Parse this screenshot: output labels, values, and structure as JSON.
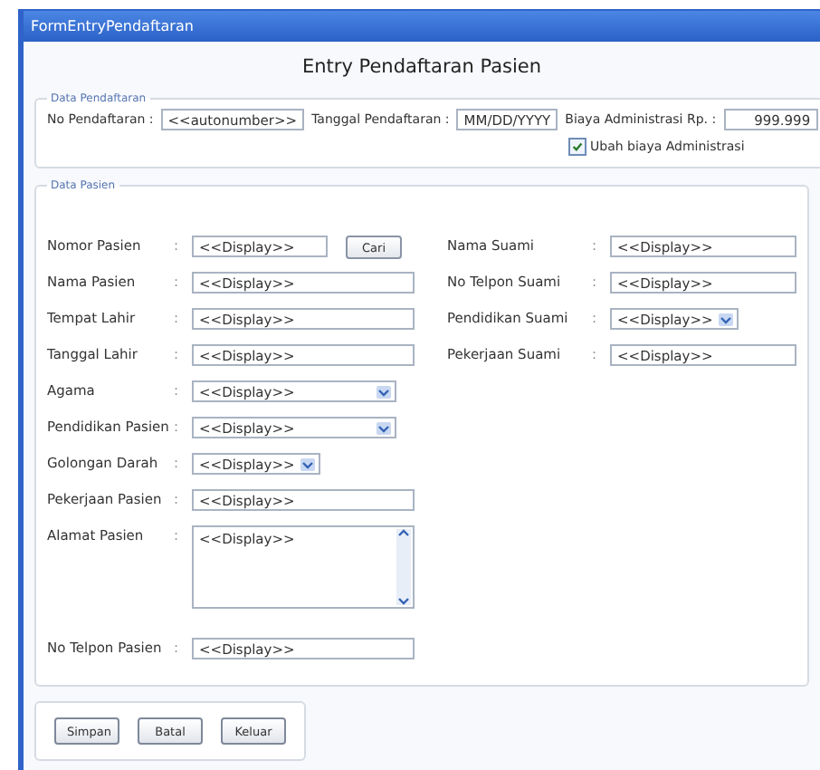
{
  "window": {
    "title": "FormEntryPendaftaran"
  },
  "heading": "Entry Pendaftaran Pasien",
  "registration": {
    "legend": "Data Pendaftaran",
    "fields": [
      {
        "label": "No Pendaftaran :",
        "value": "<<autonumber>>",
        "kind": "text"
      },
      {
        "label": "Tanggal Pendaftaran :",
        "value": "MM/DD/YYYY",
        "kind": "text"
      },
      {
        "label": "Biaya Administrasi  Rp. :",
        "value": "999.999",
        "kind": "amount"
      }
    ],
    "checkbox": {
      "label": "Ubah biaya Administrasi",
      "checked": true
    }
  },
  "patient": {
    "legend": "Data Pasien",
    "left": [
      {
        "label": "Nomor Pasien",
        "colon": ":",
        "value": "<<Display>>",
        "kind": "lookup",
        "button": "Cari"
      },
      {
        "label": "Nama Pasien",
        "colon": ":",
        "value": "<<Display>>",
        "kind": "text"
      },
      {
        "label": "Tempat Lahir",
        "colon": ":",
        "value": "<<Display>>",
        "kind": "text"
      },
      {
        "label": "Tanggal Lahir",
        "colon": ":",
        "value": "<<Display>>",
        "kind": "text"
      },
      {
        "label": "Agama",
        "colon": ":",
        "value": "<<Display>>",
        "kind": "combo"
      },
      {
        "label": "Pendidikan Pasien",
        "colon": ":",
        "value": "<<Display>>",
        "kind": "combo"
      },
      {
        "label": "Golongan Darah",
        "colon": ":",
        "value": "<<Display>>",
        "kind": "combo_short"
      },
      {
        "label": "Pekerjaan Pasien",
        "colon": ":",
        "value": "<<Display>>",
        "kind": "text"
      },
      {
        "label": "Alamat Pasien",
        "colon": ":",
        "value": "<<Display>>",
        "kind": "textarea"
      },
      {
        "label": "No Telpon Pasien",
        "colon": ":",
        "value": "<<Display>>",
        "kind": "text"
      }
    ],
    "right": [
      {
        "label": "Nama Suami",
        "colon": ":",
        "value": "<<Display>>",
        "kind": "text"
      },
      {
        "label": "No Telpon Suami",
        "colon": ":",
        "value": "<<Display>>",
        "kind": "text"
      },
      {
        "label": "Pendidikan Suami",
        "colon": ":",
        "value": "<<Display>>",
        "kind": "combo_short"
      },
      {
        "label": "Pekerjaan Suami",
        "colon": ":",
        "value": "<<Display>>",
        "kind": "text"
      }
    ]
  },
  "buttons": [
    "Simpan",
    "Batal",
    "Keluar"
  ]
}
